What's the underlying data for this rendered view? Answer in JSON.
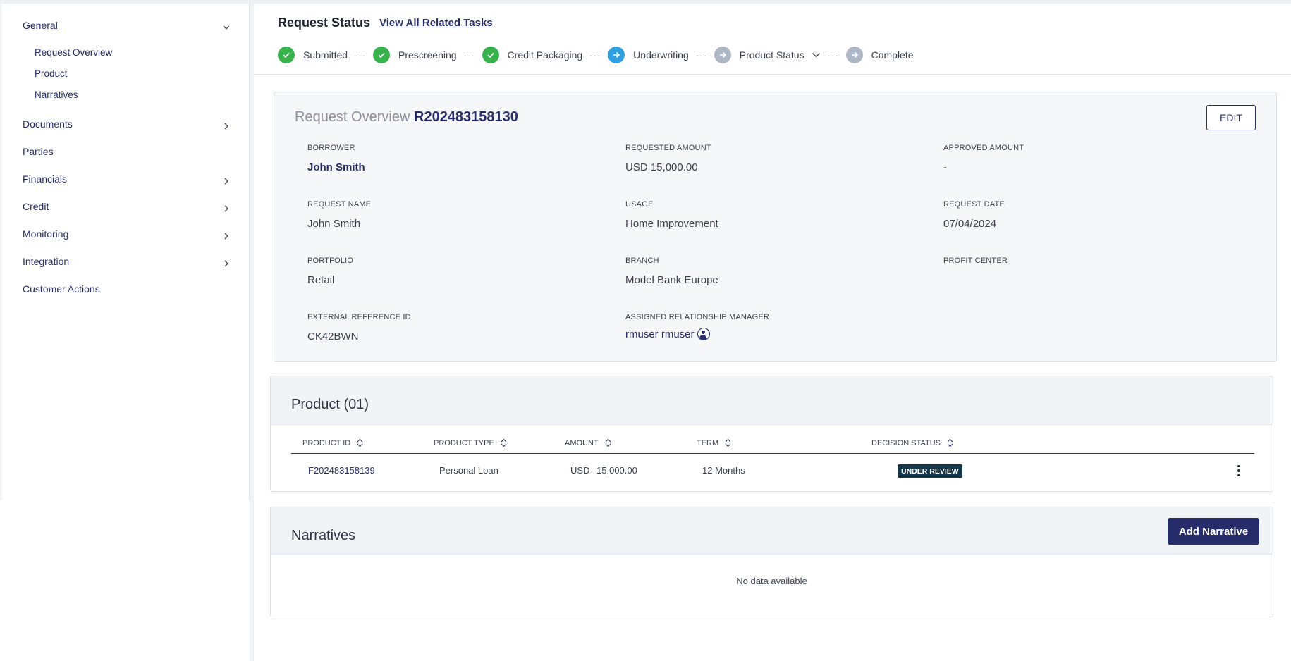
{
  "sidebar": {
    "items": [
      {
        "label": "General",
        "expandable": true,
        "expanded": true
      },
      {
        "label": "Documents",
        "expandable": true
      },
      {
        "label": "Parties",
        "expandable": false
      },
      {
        "label": "Financials",
        "expandable": true
      },
      {
        "label": "Credit",
        "expandable": true
      },
      {
        "label": "Monitoring",
        "expandable": true
      },
      {
        "label": "Integration",
        "expandable": true
      },
      {
        "label": "Customer Actions",
        "expandable": false
      }
    ],
    "general_sub": [
      "Request Overview",
      "Product",
      "Narratives"
    ]
  },
  "header": {
    "title": "Request Status",
    "related_link": "View All Related Tasks",
    "steps": [
      {
        "label": "Submitted",
        "state": "done"
      },
      {
        "label": "Prescreening",
        "state": "done"
      },
      {
        "label": "Credit Packaging",
        "state": "done"
      },
      {
        "label": "Underwriting",
        "state": "current"
      },
      {
        "label": "Product Status",
        "state": "pending"
      },
      {
        "label": "Complete",
        "state": "pending"
      }
    ],
    "separator": "---"
  },
  "overview": {
    "label": "Request Overview",
    "id": "R202483158130",
    "edit_label": "EDIT",
    "fields": {
      "borrower": {
        "label": "BORROWER",
        "value": "John Smith"
      },
      "requested_amount": {
        "label": "REQUESTED AMOUNT",
        "value": "USD 15,000.00"
      },
      "approved_amount": {
        "label": "APPROVED AMOUNT",
        "value": "-"
      },
      "request_name": {
        "label": "REQUEST NAME",
        "value": "John Smith"
      },
      "usage": {
        "label": "USAGE",
        "value": "Home Improvement"
      },
      "request_date": {
        "label": "REQUEST DATE",
        "value": "07/04/2024"
      },
      "portfolio": {
        "label": "PORTFOLIO",
        "value": "Retail"
      },
      "branch": {
        "label": "BRANCH",
        "value": "Model Bank Europe"
      },
      "profit_center": {
        "label": "PROFIT CENTER",
        "value": ""
      },
      "external_ref": {
        "label": "EXTERNAL REFERENCE ID",
        "value": "CK42BWN"
      },
      "rm": {
        "label": "ASSIGNED RELATIONSHIP MANAGER",
        "value": "rmuser rmuser"
      }
    }
  },
  "product": {
    "title": "Product (01)",
    "columns": [
      "PRODUCT ID",
      "PRODUCT TYPE",
      "AMOUNT",
      "TERM",
      "DECISION STATUS"
    ],
    "rows": [
      {
        "id": "F202483158139",
        "type": "Personal Loan",
        "currency": "USD",
        "amount": "15,000.00",
        "term": "12 Months",
        "status": "UNDER REVIEW"
      }
    ]
  },
  "narratives": {
    "title": "Narratives",
    "add_label": "Add Narrative",
    "empty": "No data available"
  },
  "colors": {
    "brand": "#262d6a",
    "done": "#37b24d",
    "current": "#2f9fe0",
    "pending": "#aeb7c6",
    "badge": "#13364a"
  }
}
